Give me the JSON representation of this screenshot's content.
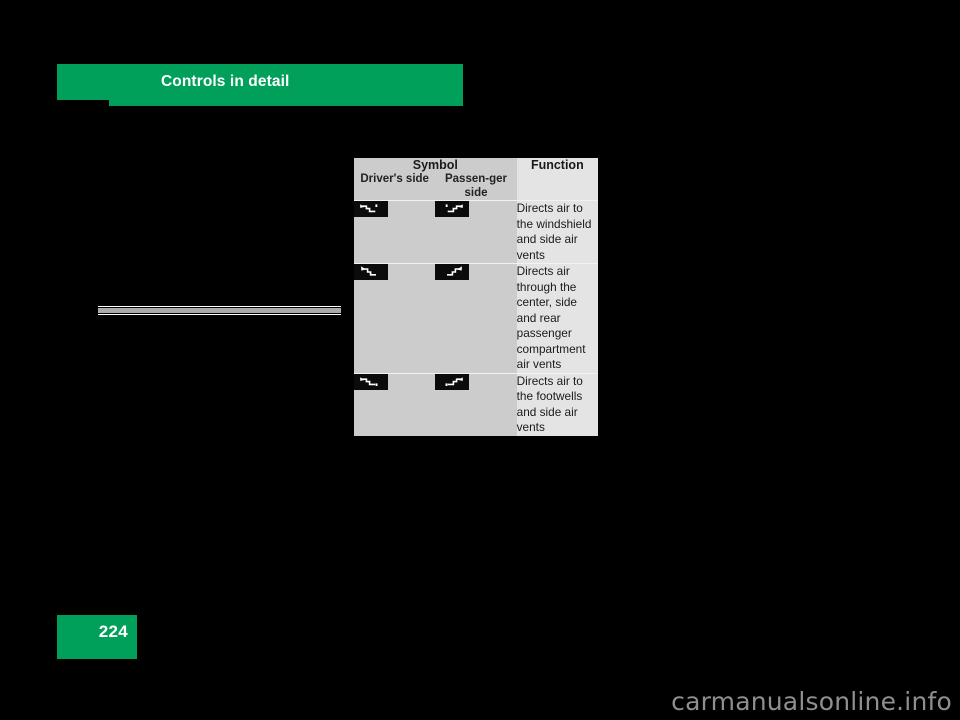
{
  "page": {
    "background_color": "#000000",
    "accent_color": "#00a05a",
    "number": "224",
    "watermark": "carmanualsonline.info"
  },
  "header": {
    "title": "Controls in detail"
  },
  "table": {
    "group_headers": {
      "symbol": "Symbol",
      "function": "Function"
    },
    "sub_headers": {
      "driver": "Driver's side",
      "passenger": "Passen-ger side"
    },
    "rows": [
      {
        "driver_symbol_name": "air-to-windshield-driver-icon",
        "passenger_symbol_name": "air-to-windshield-passenger-icon",
        "function": "Directs air to the windshield and side air vents"
      },
      {
        "driver_symbol_name": "air-to-center-vents-driver-icon",
        "passenger_symbol_name": "air-to-center-vents-passenger-icon",
        "function": "Directs air through the center, side and rear passenger compartment air vents"
      },
      {
        "driver_symbol_name": "air-to-footwell-driver-icon",
        "passenger_symbol_name": "air-to-footwell-passenger-icon",
        "function": "Directs air to the footwells and side air vents"
      }
    ]
  }
}
